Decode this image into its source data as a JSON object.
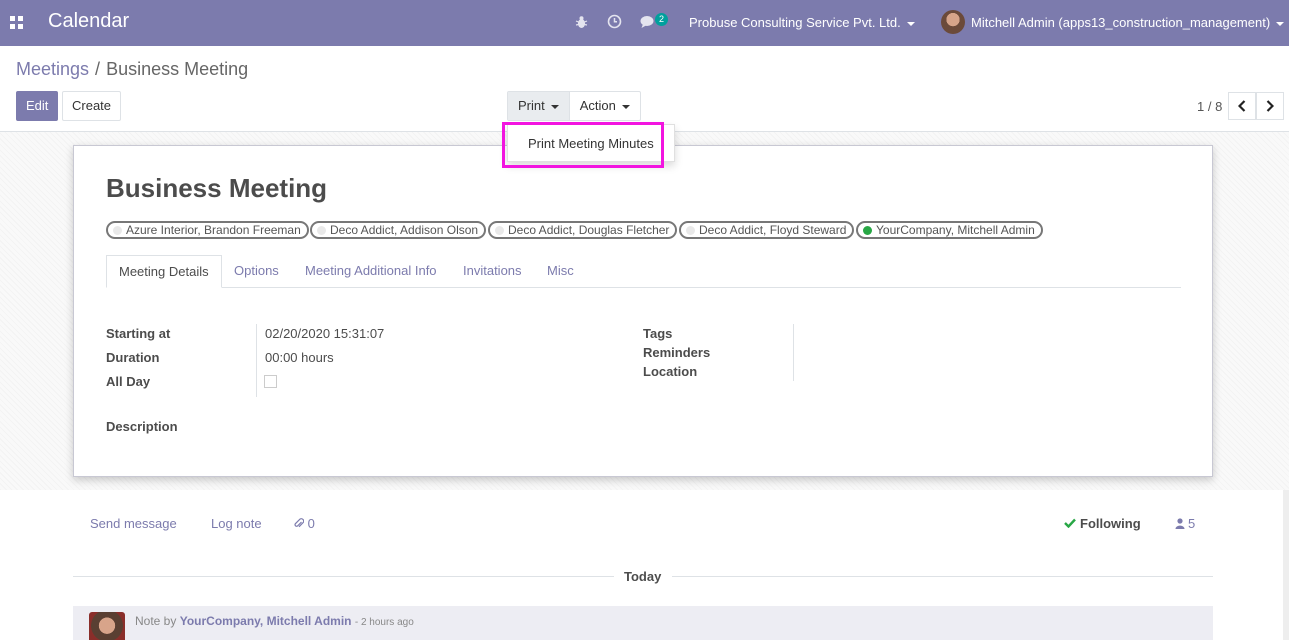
{
  "navbar": {
    "app_title": "Calendar",
    "chat_count": "2",
    "company": "Probuse Consulting Service Pvt. Ltd.",
    "user": "Mitchell Admin (apps13_construction_management)"
  },
  "breadcrumb": {
    "parent": "Meetings",
    "separator": "/",
    "current": "Business Meeting"
  },
  "buttons": {
    "edit": "Edit",
    "create": "Create",
    "print": "Print",
    "action": "Action"
  },
  "print_menu": {
    "item": "Print Meeting Minutes"
  },
  "pager": {
    "value": "1 / 8"
  },
  "record": {
    "title": "Business Meeting",
    "attendees": [
      {
        "name": "Azure Interior, Brandon Freeman",
        "online": false
      },
      {
        "name": "Deco Addict, Addison Olson",
        "online": false
      },
      {
        "name": "Deco Addict, Douglas Fletcher",
        "online": false
      },
      {
        "name": "Deco Addict, Floyd Steward",
        "online": false
      },
      {
        "name": "YourCompany, Mitchell Admin",
        "online": true
      }
    ]
  },
  "tabs": [
    "Meeting Details",
    "Options",
    "Meeting Additional Info",
    "Invitations",
    "Misc"
  ],
  "fields": {
    "starting_at_label": "Starting at",
    "starting_at_value": "02/20/2020 15:31:07",
    "duration_label": "Duration",
    "duration_value": "00:00 hours",
    "all_day_label": "All Day",
    "all_day_checked": false,
    "tags_label": "Tags",
    "reminders_label": "Reminders",
    "location_label": "Location",
    "description_label": "Description"
  },
  "chatter": {
    "send_message": "Send message",
    "log_note": "Log note",
    "attachments": "0",
    "following": "Following",
    "followers": "5",
    "today": "Today",
    "note_prefix": "Note by",
    "note_author": "YourCompany, Mitchell Admin",
    "note_time": "- 2 hours ago"
  },
  "colors": {
    "brand": "#7c7bad",
    "highlight": "#f214e0",
    "online": "#28a745"
  }
}
